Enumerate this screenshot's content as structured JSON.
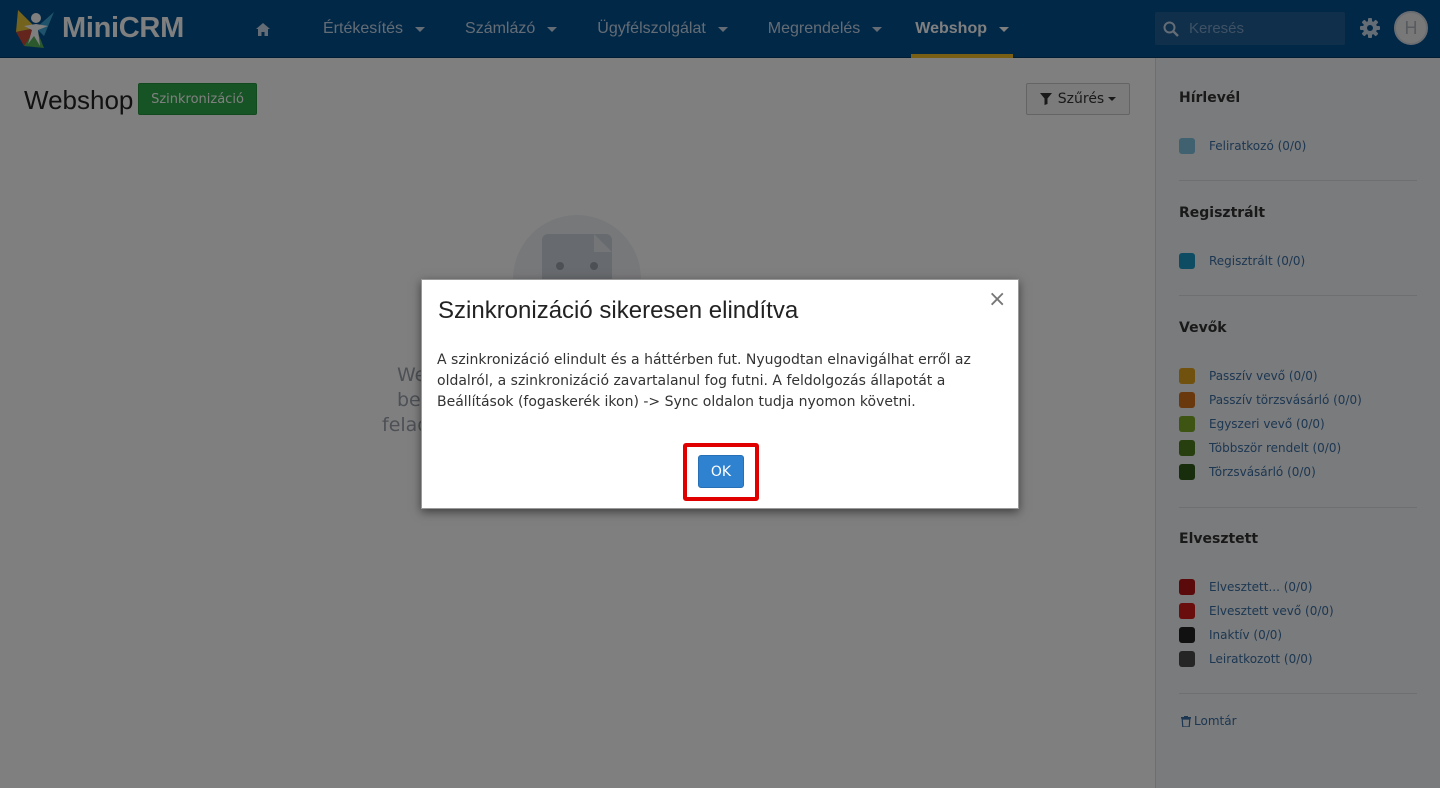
{
  "app": {
    "name": "MiniCRM"
  },
  "nav": {
    "items": [
      {
        "label": "Értékesítés"
      },
      {
        "label": "Számlázó"
      },
      {
        "label": "Ügyfélszolgálat"
      },
      {
        "label": "Megrendelés"
      },
      {
        "label": "Webshop",
        "active": true
      }
    ]
  },
  "search": {
    "placeholder": "Keresés"
  },
  "user": {
    "initial": "H"
  },
  "page": {
    "title": "Webshop",
    "sync_button": "Szinkronizáció",
    "filter_button": "Szűrés",
    "empty_text": "We\nbe\nfelad"
  },
  "sidebar": {
    "sections": [
      {
        "heading": "Hírlevél",
        "items": [
          {
            "label": "Feliratkozó (0/0)",
            "color": "#7fc3e0"
          }
        ]
      },
      {
        "heading": "Regisztrált",
        "items": [
          {
            "label": "Regisztrált (0/0)",
            "color": "#1b99c4"
          }
        ]
      },
      {
        "heading": "Vevők",
        "items": [
          {
            "label": "Passzív vevő (0/0)",
            "color": "#e0a31b"
          },
          {
            "label": "Passzív törzsvásárló (0/0)",
            "color": "#d4711a"
          },
          {
            "label": "Egyszeri vevő (0/0)",
            "color": "#7aa826"
          },
          {
            "label": "Többször rendelt (0/0)",
            "color": "#4f7d1d"
          },
          {
            "label": "Törzsvásárló (0/0)",
            "color": "#2f5a17"
          }
        ]
      },
      {
        "heading": "Elvesztett",
        "items": [
          {
            "label": "Elvesztett... (0/0)",
            "color": "#b51515"
          },
          {
            "label": "Elvesztett vevő (0/0)",
            "color": "#d21a1a"
          },
          {
            "label": "Inaktív (0/0)",
            "color": "#222222"
          },
          {
            "label": "Leiratkozott (0/0)",
            "color": "#4a4a4a"
          }
        ]
      }
    ],
    "trash_label": "Lomtár"
  },
  "modal": {
    "title": "Szinkronizáció sikeresen elindítva",
    "body": "A szinkronizáció elindult és a háttérben fut. Nyugodtan elnavigálhat erről az oldalról, a szinkronizáció zavartalanul fog futni. A feldolgozás állapotát a Beállítások (fogaskerék ikon) -> Sync oldalon tudja nyomon követni.",
    "close_symbol": "×",
    "ok_label": "OK"
  },
  "colors": {
    "navbar": "#04508f",
    "active_underline": "#f0bf28",
    "sync_button": "#2ea84a",
    "ok_button": "#2f82d0",
    "highlight": "#e00000"
  }
}
